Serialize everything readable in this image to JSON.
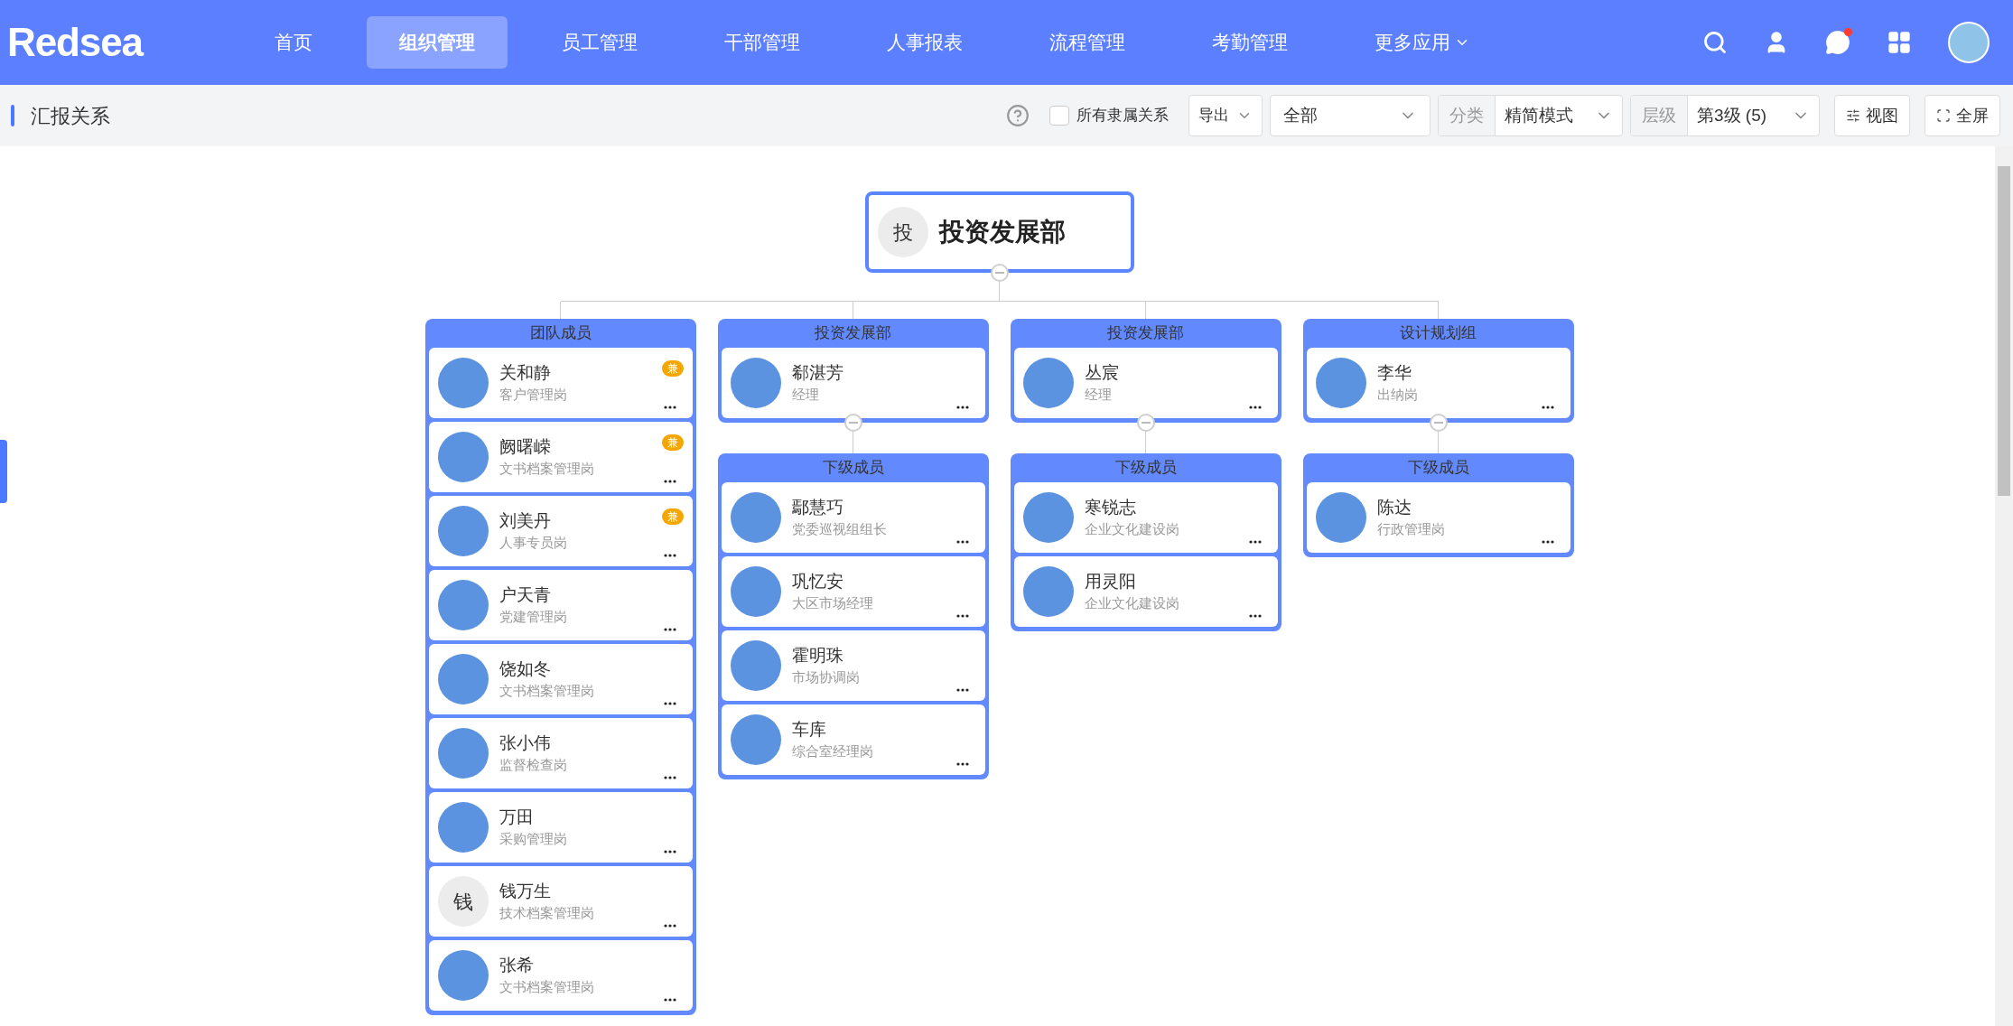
{
  "logo": "Redsea",
  "nav": [
    {
      "label": "首页",
      "selected": false,
      "dropdown": false
    },
    {
      "label": "组织管理",
      "selected": true,
      "dropdown": false
    },
    {
      "label": "员工管理",
      "selected": false,
      "dropdown": false
    },
    {
      "label": "干部管理",
      "selected": false,
      "dropdown": false
    },
    {
      "label": "人事报表",
      "selected": false,
      "dropdown": false
    },
    {
      "label": "流程管理",
      "selected": false,
      "dropdown": false
    },
    {
      "label": "考勤管理",
      "selected": false,
      "dropdown": false
    },
    {
      "label": "更多应用",
      "selected": false,
      "dropdown": true
    }
  ],
  "notification_dot": true,
  "page_title": "汇报关系",
  "toolbar": {
    "checkbox": {
      "label": "所有隶属关系",
      "checked": false
    },
    "export": "导出",
    "scope": "全部",
    "category": {
      "label": "分类",
      "value": "精简模式"
    },
    "level": {
      "label": "层级",
      "value": "第3级 (5)"
    },
    "buttons": [
      {
        "kind": "view",
        "label": "视图"
      },
      {
        "kind": "fullscreen",
        "label": "全屏"
      }
    ]
  },
  "root": {
    "initial": "投",
    "name": "投资发展部",
    "expanded": true
  },
  "columns": [
    {
      "title": "团队成员",
      "members": [
        {
          "name": "关和静",
          "role": "客户管理岗",
          "badge": "兼"
        },
        {
          "name": "阙曙嵘",
          "role": "文书档案管理岗",
          "badge": "兼"
        },
        {
          "name": "刘美丹",
          "role": "人事专员岗",
          "badge": "兼"
        },
        {
          "name": "户天青",
          "role": "党建管理岗"
        },
        {
          "name": "饶如冬",
          "role": "文书档案管理岗"
        },
        {
          "name": "张小伟",
          "role": "监督检查岗"
        },
        {
          "name": "万田",
          "role": "采购管理岗"
        },
        {
          "name": "钱万生",
          "role": "技术档案管理岗",
          "avatar_text": "钱"
        },
        {
          "name": "张希",
          "role": "文书档案管理岗"
        }
      ]
    },
    {
      "title": "投资发展部",
      "expanded": true,
      "members": [
        {
          "name": "郗湛芳",
          "role": "经理"
        }
      ],
      "sub": {
        "title": "下级成员",
        "members": [
          {
            "name": "鄢慧巧",
            "role": "党委巡视组组长"
          },
          {
            "name": "巩忆安",
            "role": "大区市场经理"
          },
          {
            "name": "霍明珠",
            "role": "市场协调岗"
          },
          {
            "name": "车库",
            "role": "综合室经理岗"
          }
        ]
      }
    },
    {
      "title": "投资发展部",
      "expanded": true,
      "members": [
        {
          "name": "丛宸",
          "role": "经理"
        }
      ],
      "sub": {
        "title": "下级成员",
        "members": [
          {
            "name": "寒锐志",
            "role": "企业文化建设岗"
          },
          {
            "name": "用灵阳",
            "role": "企业文化建设岗"
          }
        ]
      }
    },
    {
      "title": "设计规划组",
      "expanded": true,
      "members": [
        {
          "name": "李华",
          "role": "出纳岗"
        }
      ],
      "sub": {
        "title": "下级成员",
        "members": [
          {
            "name": "陈达",
            "role": "行政管理岗"
          }
        ]
      }
    }
  ]
}
